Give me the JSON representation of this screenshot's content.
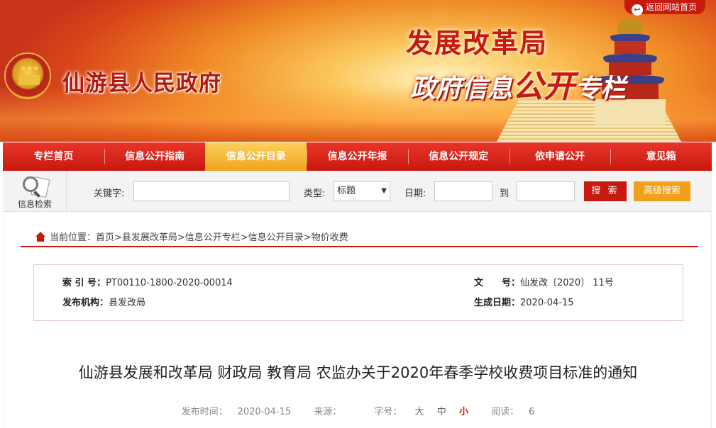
{
  "header": {
    "gov_name": "仙游县人民政府",
    "dept_title": "发展改革局",
    "column_title_part1": "政府信息",
    "column_title_part2": "公开",
    "column_title_part3": "专栏",
    "back_home": "返回网站首页"
  },
  "nav": {
    "items": [
      "专栏首页",
      "信息公开指南",
      "信息公开目录",
      "信息公开年报",
      "信息公开规定",
      "依申请公开",
      "意见箱"
    ],
    "active_index": 2
  },
  "search": {
    "icon_label": "信息检索",
    "keyword_label": "关键字:",
    "keyword_value": "",
    "type_label": "类型:",
    "type_selected": "标题",
    "date_label": "日期:",
    "date_from": "",
    "to_label": "到",
    "date_to": "",
    "search_button": "搜 索",
    "advanced_button": "高级搜索"
  },
  "breadcrumb": {
    "text": "当前位置：首页>县发展改革局>信息公开专栏>信息公开目录>物价收费"
  },
  "meta": {
    "index_label": "索 引 号：",
    "index_value": "PT00110-1800-2020-00014",
    "docno_label": "文　　号：",
    "docno_value": "仙发改〔2020〕 11号",
    "publisher_label": "发布机构：",
    "publisher_value": "县发改局",
    "date_label": "生成日期：",
    "date_value": "2020-04-15"
  },
  "document": {
    "title": "仙游县发展和改革局 财政局 教育局 农监办关于2020年春季学校收费项目标准的通知",
    "publish_time_label": "发布时间：",
    "publish_time": "2020-04-15",
    "source_label": "来源：",
    "source_value": "",
    "font_size_label": "字号：",
    "size_large": "大",
    "size_medium": "中",
    "size_small": "小",
    "views_label": "阅读：",
    "views": "6"
  },
  "colors": {
    "brand_red": "#c8190e",
    "accent_orange": "#f0a01a"
  }
}
